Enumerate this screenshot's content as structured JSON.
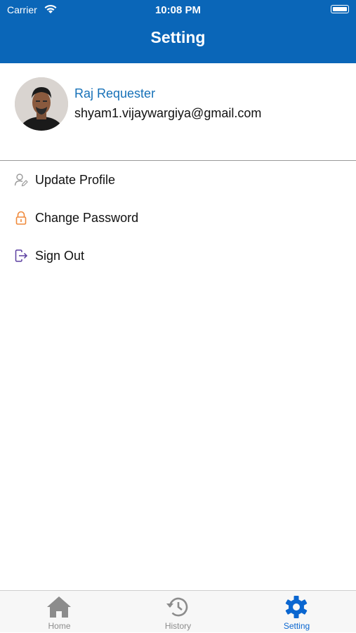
{
  "status_bar": {
    "carrier": "Carrier",
    "time": "10:08 PM"
  },
  "header": {
    "title": "Setting"
  },
  "profile": {
    "name": "Raj Requester",
    "email": "shyam1.vijaywargiya@gmail.com"
  },
  "menu": [
    {
      "label": "Update Profile",
      "icon": "user-edit-icon"
    },
    {
      "label": "Change Password",
      "icon": "lock-icon"
    },
    {
      "label": "Sign Out",
      "icon": "sign-out-icon"
    }
  ],
  "tabs": [
    {
      "label": "Home",
      "icon": "home-icon"
    },
    {
      "label": "History",
      "icon": "history-icon"
    },
    {
      "label": "Setting",
      "icon": "gear-icon",
      "active": true
    }
  ],
  "colors": {
    "brand": "#0a66b8",
    "name_text": "#1671b8",
    "active_tab": "#0a66d0",
    "inactive_tab": "#8c8c8c",
    "lock_icon": "#f08a3c",
    "sign_out_icon": "#5b3fa0"
  }
}
